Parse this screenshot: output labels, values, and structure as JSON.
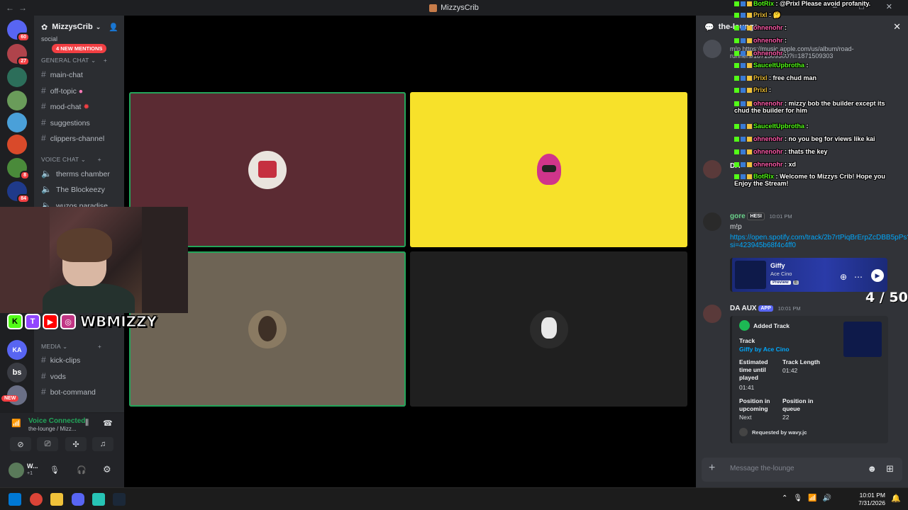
{
  "window": {
    "title": "MizzysCrib",
    "back": "←",
    "forward": "→",
    "controls": "‒ □ ✕"
  },
  "servers": [
    {
      "name": "discord-home",
      "badge": "60",
      "color": "#5865f2"
    },
    {
      "name": "server-2",
      "badge": "27",
      "color": "#b0434b"
    },
    {
      "name": "server-3",
      "badge": "",
      "color": "#2c6e5a"
    },
    {
      "name": "server-4",
      "badge": "",
      "color": "#6a9c5a"
    },
    {
      "name": "server-5",
      "badge": "",
      "color": "#4aa0d9"
    },
    {
      "name": "server-6",
      "badge": "",
      "color": "#d94a2a"
    },
    {
      "name": "server-7",
      "badge": "8",
      "color": "#4a8a3a"
    },
    {
      "name": "server-8",
      "badge": "84",
      "color": "#1f3a8a"
    }
  ],
  "bottom_servers": [
    {
      "name": "server-ka",
      "text": "KA",
      "color": "#5865f2"
    },
    {
      "name": "server-bs",
      "text": "bs",
      "color": "#3a3c43"
    },
    {
      "name": "server-new",
      "text": "NEW",
      "color": "#f23f43"
    }
  ],
  "sidebar": {
    "server_name": "MizzysCrib",
    "social_label": "social",
    "mentions_pill": "4 NEW MENTIONS",
    "general_category": "GENERAL CHAT",
    "text_channels": [
      "main-chat",
      "off-topic",
      "mod-chat",
      "suggestions",
      "clippers-channel"
    ],
    "voice_category": "VOICE CHAT",
    "voice_channels": [
      "therms chamber",
      "The Blockeezy",
      "wuzos paradise"
    ],
    "media_category": "MEDIA",
    "media_channels": [
      "kick-clips",
      "vods",
      "bot-command"
    ]
  },
  "voice": {
    "status": "Voice Connected",
    "location": "the-lounge / Mizz...",
    "user": "W...",
    "user_sub": "+1"
  },
  "stage": {
    "tiles": [
      {
        "name": "tile-red",
        "bg": "#5b2b33",
        "speaking": true
      },
      {
        "name": "tile-yellow",
        "bg": "#f7e12a",
        "speaking": false
      },
      {
        "name": "tile-tan",
        "bg": "#6e6455",
        "speaking": true
      },
      {
        "name": "tile-dark",
        "bg": "#1f1f1f",
        "speaking": false
      }
    ]
  },
  "stream_overlay": {
    "socials": [
      "K",
      "T",
      "▶",
      "◎"
    ],
    "handle": "WBMIZZY",
    "counter": "4 / 50"
  },
  "chat": {
    "channel": "the-lounge",
    "input_placeholder": "Message the-lounge",
    "top_text": "m!p https://music.apple.com/us/album/road-runners/1871509300?i=1871509303",
    "dj_author": "DA",
    "gore": {
      "name": "gore",
      "badge": "HESI",
      "time": "10:01 PM",
      "text": "m!p",
      "link": "https://open.spotify.com/track/2b7rtPiqBrErpZcDBB5pPs?si=423945b68f4c4ff0"
    },
    "spotify_embed": {
      "title": "Giffy",
      "artist": "Ace Cino",
      "preview": "Preview",
      "explicit": "E"
    },
    "aux": {
      "name": "DA AUX",
      "badge": "APP",
      "time": "10:01 PM",
      "embed_title": "Added Track",
      "track_label": "Track",
      "track_value": "Giffy by Ace Cino",
      "est_label": "Estimated time until played",
      "est_value": "01:41",
      "len_label": "Track Length",
      "len_value": "01:42",
      "pos_up_label": "Position in upcoming",
      "pos_up_value": "Next",
      "pos_q_label": "Position in queue",
      "pos_q_value": "22",
      "requested": "Requested by wavy.jc"
    }
  },
  "kick_chat": [
    {
      "user": "BotRix",
      "color": "#53fc18",
      "text": "@Prixl Please avoid profanity."
    },
    {
      "user": "Prixl",
      "color": "#f0c23a",
      "text": "🤔"
    },
    {
      "user": "ohnenohr",
      "color": "#ff5cab",
      "text": ""
    },
    {
      "user": "ohnenohr",
      "color": "#ff5cab",
      "text": ""
    },
    {
      "user": "ohnenohr",
      "color": "#ff5cab",
      "text": ""
    },
    {
      "user": "SauceItUpbrotha",
      "color": "#53fc18",
      "text": ""
    },
    {
      "user": "Prixl",
      "color": "#f0c23a",
      "text": "free chud man"
    },
    {
      "user": "Prixl",
      "color": "#f0c23a",
      "text": ""
    },
    {
      "user": "ohnenohr",
      "color": "#ff5cab",
      "text": "mizzy bob the builder except its chud the builder for him"
    },
    {
      "user": "SauceItUpbrotha",
      "color": "#53fc18",
      "text": ""
    },
    {
      "user": "ohnenohr",
      "color": "#ff5cab",
      "text": "no you beg for views like kai"
    },
    {
      "user": "ohnenohr",
      "color": "#ff5cab",
      "text": "thats the key"
    },
    {
      "user": "ohnenohr",
      "color": "#ff5cab",
      "text": "xd"
    },
    {
      "user": "BotRix",
      "color": "#53fc18",
      "text": "Welcome to Mizzys Crib! Hope you Enjoy the Stream!"
    }
  ],
  "taskbar": {
    "time": "10:01 PM",
    "date": "7/31/2026"
  }
}
